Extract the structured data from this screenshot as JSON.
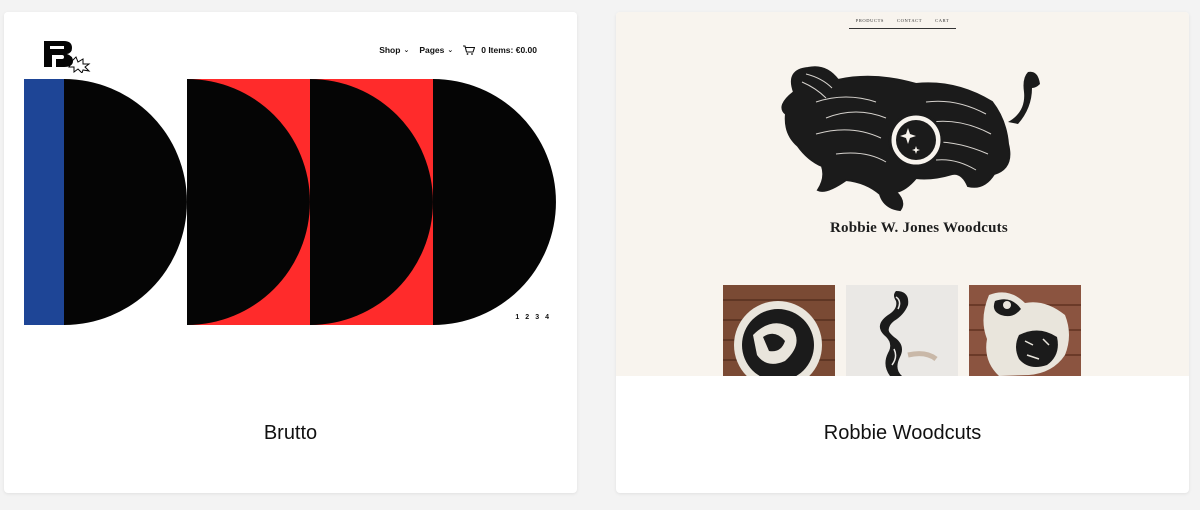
{
  "cards": [
    {
      "title": "Brutto",
      "preview": {
        "nav": {
          "shop": "Shop",
          "pages": "Pages",
          "cart": "0 Items: €0.00"
        },
        "pagination": [
          "1",
          "2",
          "3",
          "4"
        ],
        "colors": {
          "blue": "#1e4596",
          "red": "#ff2b2b",
          "black": "#050505"
        }
      }
    },
    {
      "title": "Robbie Woodcuts",
      "preview": {
        "nav": [
          "PRODUCTS",
          "CONTACT",
          "CART"
        ],
        "brand": "Robbie W. Jones Woodcuts",
        "background": "#f8f4ee"
      }
    }
  ]
}
